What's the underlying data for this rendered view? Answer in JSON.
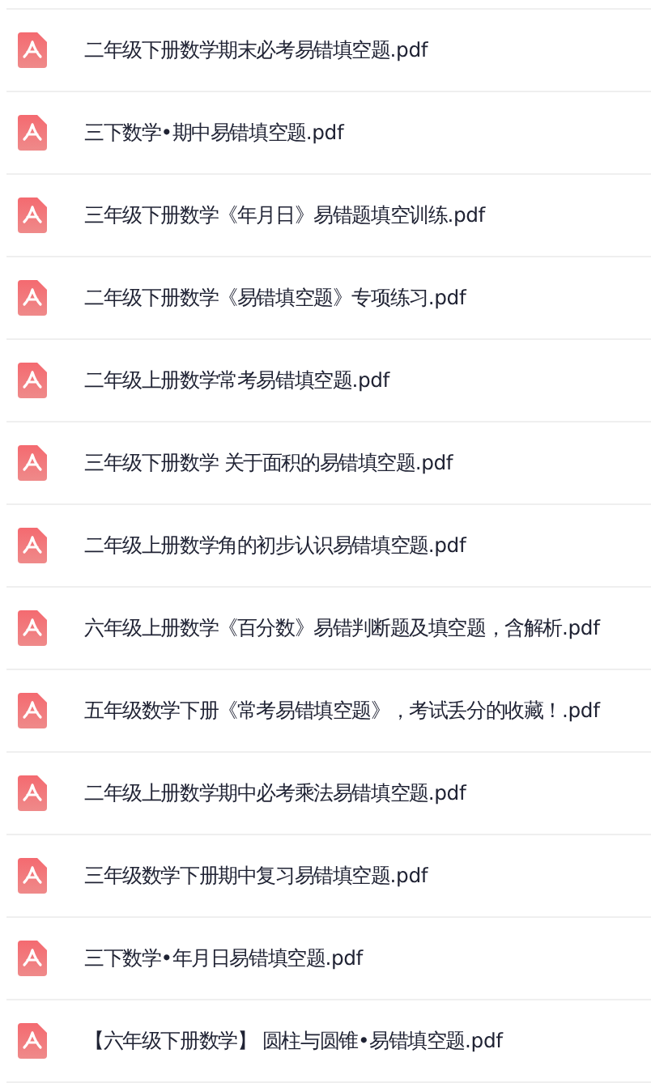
{
  "files": [
    {
      "name": "二年级下册数学期末必考易错填空题.pdf"
    },
    {
      "name": "三下数学•期中易错填空题.pdf"
    },
    {
      "name": "三年级下册数学《年月日》易错题填空训练.pdf"
    },
    {
      "name": "二年级下册数学《易错填空题》专项练习.pdf"
    },
    {
      "name": "二年级上册数学常考易错填空题.pdf"
    },
    {
      "name": "三年级下册数学 关于面积的易错填空题.pdf"
    },
    {
      "name": "二年级上册数学角的初步认识易错填空题.pdf"
    },
    {
      "name": "六年级上册数学《百分数》易错判断题及填空题，含解析.pdf"
    },
    {
      "name": "五年级数学下册《常考易错填空题》，考试丢分的收藏！.pdf"
    },
    {
      "name": "二年级上册数学期中必考乘法易错填空题.pdf"
    },
    {
      "name": "三年级数学下册期中复习易错填空题.pdf"
    },
    {
      "name": "三下数学•年月日易错填空题.pdf"
    },
    {
      "name": "【六年级下册数学】 圆柱与圆锥•易错填空题.pdf"
    }
  ]
}
